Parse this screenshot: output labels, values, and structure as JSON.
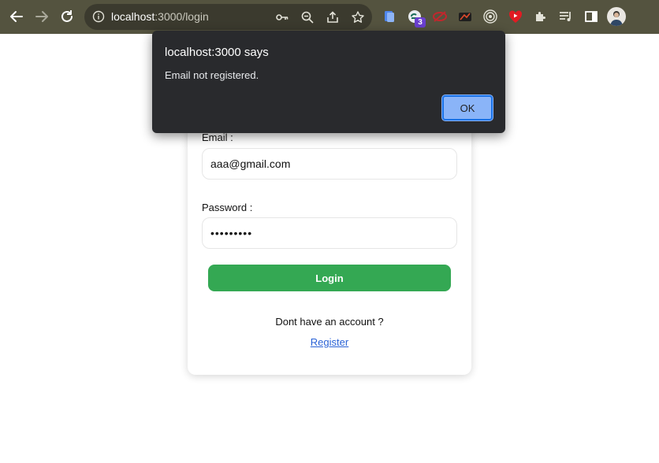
{
  "browser": {
    "url_host": "localhost",
    "url_rest": ":3000/login",
    "extension_badge": "3",
    "icons": [
      "arrow-left-icon",
      "arrow-right-icon",
      "reload-icon",
      "info-icon",
      "key-icon",
      "zoom-out-icon",
      "share-icon",
      "star-icon",
      "puzzle-icon",
      "media-icon",
      "side-panel-icon",
      "avatar"
    ],
    "colors": {
      "toolbar": "#54533f",
      "omnibox": "#3b3a2e"
    }
  },
  "dialog": {
    "title": "localhost:3000 says",
    "message": "Email not registered.",
    "ok_label": "OK",
    "colors": {
      "background": "#292a2d",
      "button": "#8ab4f8"
    }
  },
  "login_form": {
    "email_label": "Email :",
    "email_value": "aaa@gmail.com",
    "password_label": "Password :",
    "password_value": "•••••••••",
    "login_button": "Login",
    "no_account_text": "Dont have an account ?",
    "register_link": "Register",
    "colors": {
      "button": "#34a853",
      "link": "#2a62d6"
    }
  }
}
